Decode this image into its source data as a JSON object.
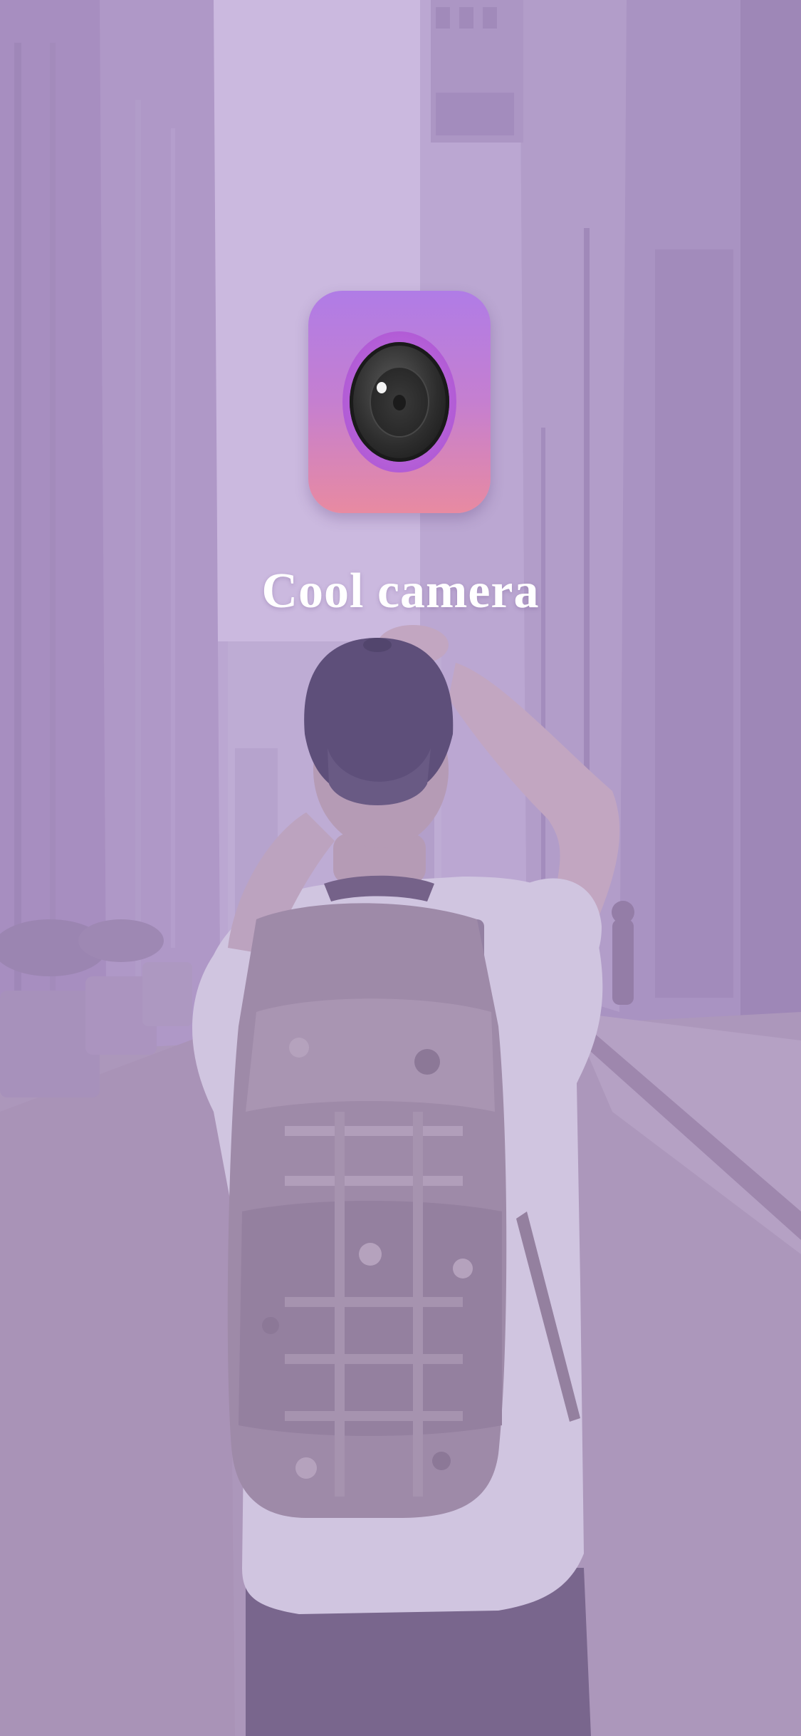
{
  "app": {
    "name": "Cool camera"
  },
  "splash": {
    "icon_name": "camera-lens-icon",
    "icon_gradient_top": "#b07ce6",
    "icon_gradient_bottom": "#e88aa1",
    "overlay_tint": "#b8a7cb"
  }
}
